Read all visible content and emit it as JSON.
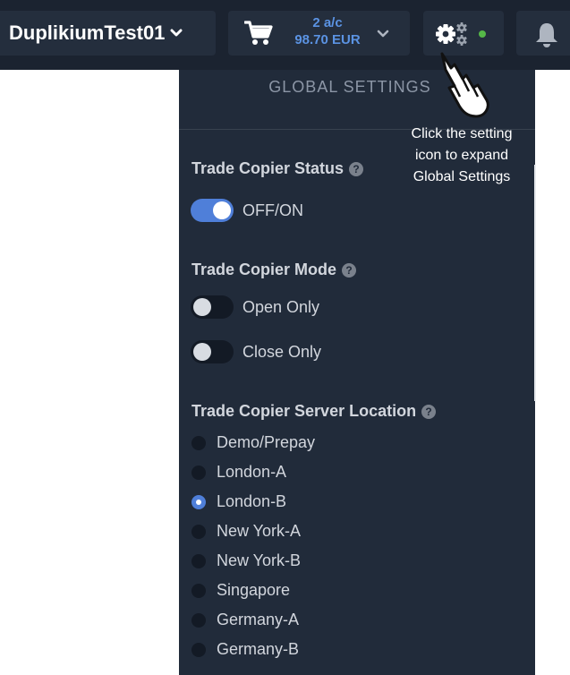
{
  "topbar": {
    "account_name": "DuplikiumTest01",
    "cart": {
      "accounts": "2 a/c",
      "amount": "98.70 EUR"
    },
    "status_color": "#55b848"
  },
  "icons": {
    "account_dropdown": "chevron-down-icon",
    "cart": "cart-icon",
    "cart_dropdown": "chevron-down-icon",
    "settings": "gear-icon",
    "notifications": "bell-icon",
    "help": "question-icon",
    "pointer": "hand-pointer-icon"
  },
  "panel": {
    "title": "GLOBAL SETTINGS",
    "status": {
      "title": "Trade Copier Status",
      "toggle_label": "OFF/ON",
      "toggle_on": true
    },
    "mode": {
      "title": "Trade Copier Mode",
      "options": [
        {
          "label": "Open Only",
          "on": false
        },
        {
          "label": "Close Only",
          "on": false
        }
      ]
    },
    "server": {
      "title": "Trade Copier Server Location",
      "options": [
        {
          "label": "Demo/Prepay",
          "selected": false
        },
        {
          "label": "London-A",
          "selected": false
        },
        {
          "label": "London-B",
          "selected": true
        },
        {
          "label": "New York-A",
          "selected": false
        },
        {
          "label": "New York-B",
          "selected": false
        },
        {
          "label": "Singapore",
          "selected": false
        },
        {
          "label": "Germany-A",
          "selected": false
        },
        {
          "label": "Germany-B",
          "selected": false
        }
      ]
    }
  },
  "annotation": {
    "line1": "Click the setting",
    "line2": "icon to expand",
    "line3": "Global Settings"
  },
  "colors": {
    "topbar_bg": "#1b2330",
    "panel_bg": "#212b3a",
    "accent_blue": "#4f7fd9"
  }
}
